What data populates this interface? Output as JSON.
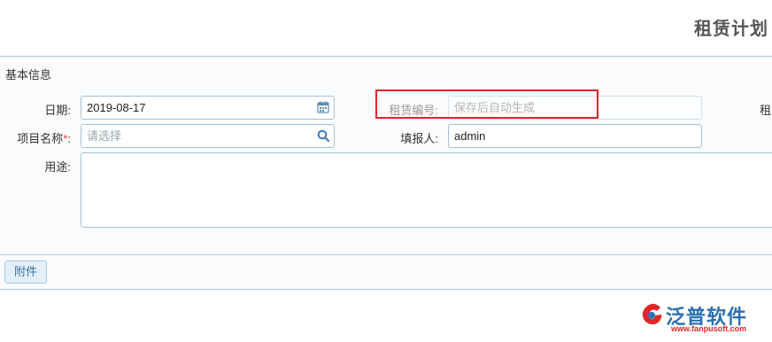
{
  "header": {
    "title": "租赁计划"
  },
  "basic_section": {
    "title": "基本信息",
    "date": {
      "label": "日期:",
      "value": "2019-08-17",
      "icon": "calendar-icon"
    },
    "rental_no": {
      "label": "租赁编号:",
      "placeholder": "保存后自动生成"
    },
    "rental_clipped_label": "租",
    "project": {
      "label": "项目名称",
      "required_mark": "*",
      "colon": ":",
      "placeholder": "请选择",
      "icon": "search-icon"
    },
    "filler": {
      "label": "填报人:",
      "value": "admin"
    },
    "purpose": {
      "label": "用途:",
      "value": ""
    }
  },
  "attachment_section": {
    "button_label": "附件"
  },
  "logo": {
    "name": "泛普软件",
    "url": "www.fanpusoft.com",
    "accent": "#2c6fb3",
    "url_color": "#e0262b"
  },
  "colors": {
    "highlight": "#e0262b",
    "border": "#a9c7d6",
    "section_bg": "#f9fbfc"
  }
}
